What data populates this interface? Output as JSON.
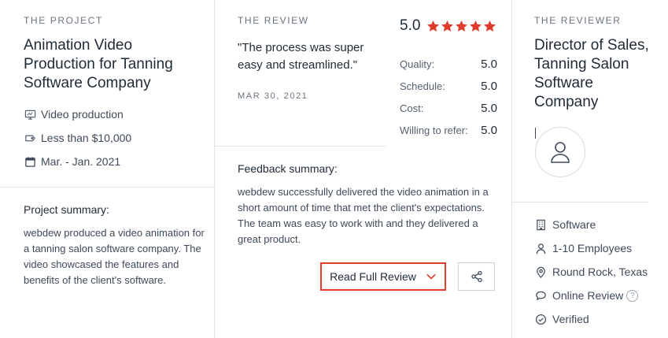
{
  "project": {
    "eyebrow": "THE PROJECT",
    "title": "Animation Video Production for Tanning Software Company",
    "meta": [
      {
        "icon": "monitor-icon",
        "text": "Video production"
      },
      {
        "icon": "price-tag-icon",
        "text": "Less than $10,000"
      },
      {
        "icon": "calendar-icon",
        "text": "Mar. - Jan. 2021"
      }
    ],
    "summary_label": "Project summary:",
    "summary": "webdew produced a video animation for a tanning salon software company. The video showcased the features and benefits of the client's software."
  },
  "review": {
    "eyebrow": "THE REVIEW",
    "quote": "\"The process was super easy and streamlined.\"",
    "date": "MAR 30, 2021",
    "overall": "5.0",
    "stars": 5,
    "scores": [
      {
        "label": "Quality:",
        "value": "5.0"
      },
      {
        "label": "Schedule:",
        "value": "5.0"
      },
      {
        "label": "Cost:",
        "value": "5.0"
      },
      {
        "label": "Willing to refer:",
        "value": "5.0"
      }
    ],
    "feedback_label": "Feedback summary:",
    "feedback": "webdew successfully delivered the video animation in a short amount of time that met the client's expectations. The team was easy to work with and they delivered a great product.",
    "read_full_label": "Read Full Review"
  },
  "reviewer": {
    "eyebrow": "THE REVIEWER",
    "title": "Director of Sales, Tanning Salon Software Company",
    "details": [
      {
        "icon": "building-icon",
        "text": "Software"
      },
      {
        "icon": "user-icon",
        "text": "1-10 Employees"
      },
      {
        "icon": "location-pin-icon",
        "text": "Round Rock, Texas"
      },
      {
        "icon": "chat-bubble-icon",
        "text": "Online Review"
      },
      {
        "icon": "check-circle-icon",
        "text": "Verified"
      }
    ],
    "help_glyph": "?"
  },
  "colors": {
    "star": "#e23c2e",
    "button_border": "#e23c2e",
    "divider": "#dfe6ea",
    "text_dark": "#1f2a36",
    "text_muted": "#6a7480"
  }
}
